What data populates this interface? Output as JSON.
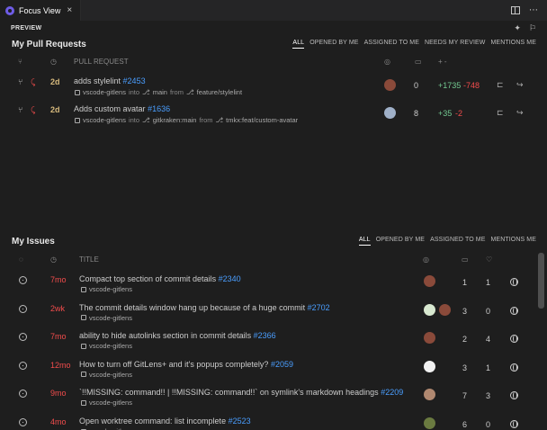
{
  "tab": {
    "title": "Focus View"
  },
  "preview": {
    "label": "PREVIEW"
  },
  "pull_requests": {
    "title": "My Pull Requests",
    "filters": [
      "ALL",
      "OPENED BY ME",
      "ASSIGNED TO ME",
      "NEEDS MY REVIEW",
      "MENTIONS ME"
    ],
    "active_filter": "ALL",
    "column_title": "PULL REQUEST",
    "column_changes": "+ -",
    "rows": [
      {
        "age": "2d",
        "title": "adds stylelint",
        "number": "#2453",
        "repo": "vscode-gitlens",
        "into_label": "into",
        "target_branch": "main",
        "from_label": "from",
        "source_branch": "feature/stylelint",
        "comments": "0",
        "additions": "+1735",
        "deletions": "-748",
        "avatar_color": "#8a4a3a"
      },
      {
        "age": "2d",
        "title": "Adds custom avatar",
        "number": "#1636",
        "repo": "vscode-gitlens",
        "into_label": "into",
        "target_branch": "gitkraken:main",
        "from_label": "from",
        "source_branch": "tmkx:feat/custom-avatar",
        "comments": "8",
        "additions": "+35",
        "deletions": "-2",
        "avatar_color": "#9fb0c8"
      }
    ]
  },
  "issues": {
    "title": "My Issues",
    "filters": [
      "ALL",
      "OPENED BY ME",
      "ASSIGNED TO ME",
      "MENTIONS ME"
    ],
    "active_filter": "ALL",
    "column_title": "TITLE",
    "rows": [
      {
        "age": "7mo",
        "title": "Compact top section of commit details",
        "number": "#2340",
        "repo": "vscode-gitlens",
        "comments": "1",
        "reactions": "1",
        "avatars": [
          "#8a4a3a"
        ]
      },
      {
        "age": "2wk",
        "title": "The commit details window hang up because of a huge commit",
        "number": "#2702",
        "repo": "vscode-gitlens",
        "comments": "3",
        "reactions": "0",
        "avatars": [
          "#d8e8d0",
          "#8a4a3a"
        ]
      },
      {
        "age": "7mo",
        "title": "ability to hide autolinks section in commit details",
        "number": "#2366",
        "repo": "vscode-gitlens",
        "comments": "2",
        "reactions": "4",
        "avatars": [
          "#8a4a3a"
        ]
      },
      {
        "age": "12mo",
        "title": "How to turn off GitLens+ and it's popups completely?",
        "number": "#2059",
        "repo": "vscode-gitlens",
        "comments": "3",
        "reactions": "1",
        "avatars": [
          "#f2f2f2"
        ]
      },
      {
        "age": "9mo",
        "title": "`!!MISSING: command!! | !!MISSING: command!!` on symlink's markdown headings",
        "number": "#2209",
        "repo": "vscode-gitlens",
        "comments": "7",
        "reactions": "3",
        "avatars": [
          "#b08870"
        ]
      },
      {
        "age": "4mo",
        "title": "Open worktree command: list incomplete",
        "number": "#2523",
        "repo": "vscode-gitlens",
        "comments": "6",
        "reactions": "0",
        "avatars": [
          "#6a7a40"
        ]
      }
    ]
  },
  "colors": {
    "background": "#1e1e1e",
    "link": "#4a9eff",
    "additions": "#73c991",
    "deletions": "#f14c4c",
    "age_recent": "#d7ba7d"
  }
}
